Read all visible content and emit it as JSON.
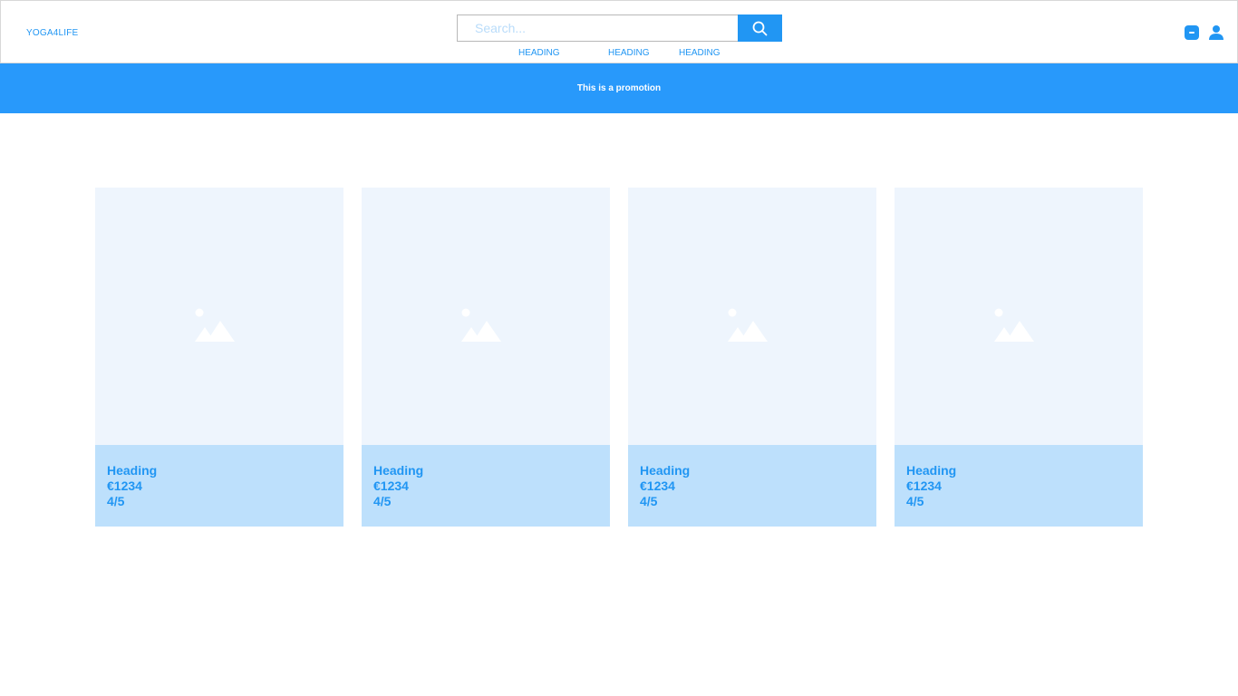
{
  "header": {
    "logo": "YOGA4LIFE",
    "search": {
      "placeholder": "Search..."
    },
    "nav": [
      "HEADING",
      "HEADING",
      "HEADING"
    ]
  },
  "promo": {
    "text": "This is a promotion"
  },
  "products": [
    {
      "heading": "Heading",
      "price": "€1234",
      "rating": "4/5"
    },
    {
      "heading": "Heading",
      "price": "€1234",
      "rating": "4/5"
    },
    {
      "heading": "Heading",
      "price": "€1234",
      "rating": "4/5"
    },
    {
      "heading": "Heading",
      "price": "€1234",
      "rating": "4/5"
    }
  ],
  "colors": {
    "accent": "#2196f3",
    "promo_bg": "#2899fb",
    "card_image_bg": "#eef5fd",
    "card_body_bg": "#bde0fc"
  },
  "icons": {
    "search": "search-icon",
    "cart": "cart-icon",
    "user": "user-icon",
    "image_placeholder": "image-placeholder-icon"
  }
}
